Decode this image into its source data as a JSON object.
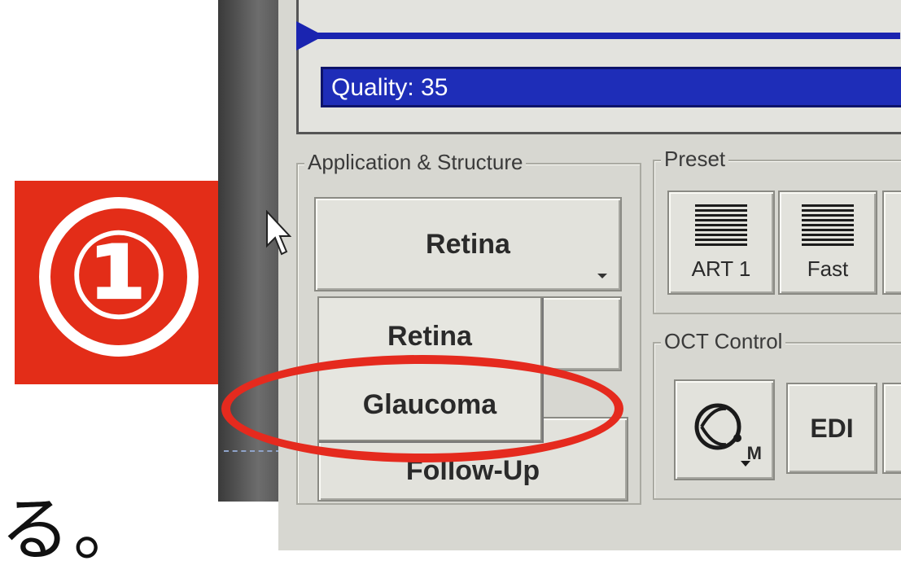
{
  "annotation": {
    "badge_number": "①",
    "caption_text": "る。",
    "badge_color": "#e32d18",
    "highlight_color": "#e52a1e"
  },
  "window": {
    "quality_label": "Quality: 35",
    "progress_color": "#1a24b0"
  },
  "application_structure": {
    "title": "Application & Structure",
    "selected_value": "Retina",
    "options": [
      "Retina",
      "Glaucoma"
    ],
    "follow_up_label": "Follow-Up"
  },
  "preset": {
    "title": "Preset",
    "buttons": [
      {
        "label": "ART 1",
        "icon": "scan-lines-icon"
      },
      {
        "label": "Fast",
        "icon": "scan-lines-icon"
      }
    ]
  },
  "oct_control": {
    "title": "OCT Control",
    "mode_indicator": "M",
    "edi_label": "EDI"
  }
}
